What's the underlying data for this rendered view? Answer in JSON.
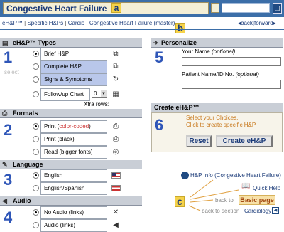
{
  "header": {
    "title": "Congestive Heart Failure",
    "badge_a": "a",
    "badge_b": "b",
    "badge_c": "c"
  },
  "breadcrumb": {
    "items": [
      "eH&P™",
      "Specific H&Ps",
      "Cardio",
      "Congestive Heart Failure"
    ],
    "suffix": "(master)",
    "separator": "|",
    "back": "back",
    "forward": "forward"
  },
  "types": {
    "header": "eH&P™ Types",
    "number": "1",
    "select_label": "select",
    "options": [
      "Brief H&P",
      "Complete H&P",
      "Signs & Symptoms",
      "Follow/up Chart"
    ],
    "followup_rows_value": "0",
    "xtra_rows_label": "Xtra rows:"
  },
  "formats": {
    "header": "Formats",
    "number": "2",
    "options": [
      "Print (",
      "color-coded",
      ")",
      "Print (black)",
      "Read (bigger fonts)"
    ]
  },
  "language": {
    "header": "Language",
    "number": "3",
    "options": [
      "English",
      "English/Spanish"
    ]
  },
  "audio": {
    "header": "Audio",
    "number": "4",
    "options": [
      "No Audio (links)",
      "Audio (links)"
    ]
  },
  "personalize": {
    "header": "Personalize",
    "number": "5",
    "name_label": "Your Name ",
    "name_optional": "(optional)",
    "name_value": "",
    "patient_label": "Patient Name/ID No. ",
    "patient_optional": "(optional)",
    "patient_value": ""
  },
  "create": {
    "header": "Create eH&P™",
    "number": "6",
    "instruction_1": "Select your Choices.",
    "instruction_2": "Click to create specific H&P.",
    "reset_label": "Reset",
    "create_label": "Create eH&P"
  },
  "help": {
    "info_link": "H&P Info (Congestive Heart Failure)",
    "quick_help": "Quick Help",
    "back_to": "back to",
    "basic_page": "Basic page",
    "back_to_section": "back to section",
    "section_link": "Cardiology"
  },
  "colors": {
    "topbar": "#3b6ea8",
    "number_blue": "#2f56b8",
    "highlight_orange": "#c8781c",
    "badge_yellow": "#f5d24a",
    "selected_option": "#b9c7ea"
  }
}
